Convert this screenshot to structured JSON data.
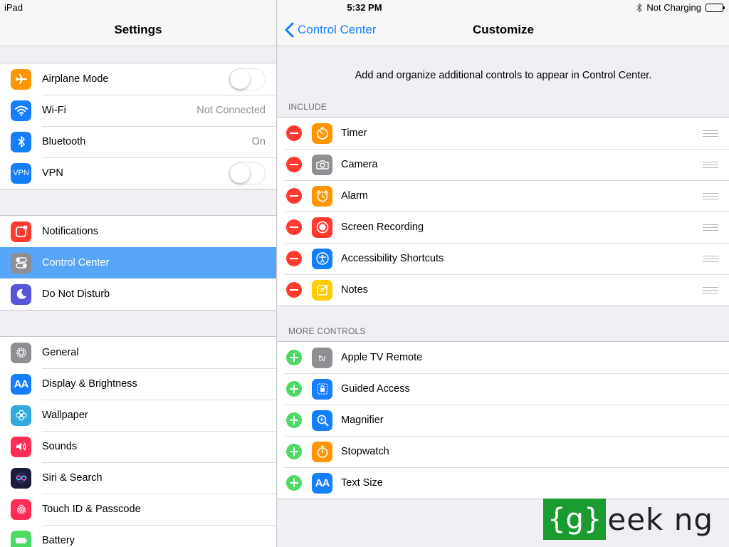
{
  "status_bar": {
    "device": "iPad",
    "time": "5:32 PM",
    "charging": "Not Charging"
  },
  "settings": {
    "title": "Settings",
    "groups": [
      [
        {
          "label": "Airplane Mode",
          "icon": "airplane-icon",
          "color": "#ff9500",
          "control": "toggle",
          "on": false
        },
        {
          "label": "Wi-Fi",
          "icon": "wifi-icon",
          "color": "#147efb",
          "value": "Not Connected"
        },
        {
          "label": "Bluetooth",
          "icon": "bluetooth-icon",
          "color": "#147efb",
          "value": "On"
        },
        {
          "label": "VPN",
          "icon": "vpn-icon",
          "icon_text": "VPN",
          "color": "#147efb",
          "control": "toggle",
          "on": false
        }
      ],
      [
        {
          "label": "Notifications",
          "icon": "notifications-icon",
          "color": "#ff3b30"
        },
        {
          "label": "Control Center",
          "icon": "control-center-icon",
          "color": "#8e8e93",
          "selected": true
        },
        {
          "label": "Do Not Disturb",
          "icon": "moon-icon",
          "color": "#5856d6"
        }
      ],
      [
        {
          "label": "General",
          "icon": "gear-icon",
          "color": "#8e8e93"
        },
        {
          "label": "Display & Brightness",
          "icon": "text-size-icon",
          "icon_text": "AA",
          "color": "#147efb"
        },
        {
          "label": "Wallpaper",
          "icon": "wallpaper-flower-icon",
          "color": "#34aadc"
        },
        {
          "label": "Sounds",
          "icon": "speaker-icon",
          "color": "#ff2d55"
        },
        {
          "label": "Siri & Search",
          "icon": "siri-icon",
          "color": "#1b1b3a"
        },
        {
          "label": "Touch ID & Passcode",
          "icon": "fingerprint-icon",
          "color": "#ff2d55"
        },
        {
          "label": "Battery",
          "icon": "battery-icon",
          "color": "#4cd964"
        }
      ]
    ]
  },
  "customize": {
    "back_label": "Control Center",
    "title": "Customize",
    "description": "Add and organize additional controls to appear in Control Center.",
    "include_header": "INCLUDE",
    "include": [
      {
        "label": "Timer",
        "icon": "timer-icon",
        "color": "#ff9500"
      },
      {
        "label": "Camera",
        "icon": "camera-icon",
        "color": "#8e8e93"
      },
      {
        "label": "Alarm",
        "icon": "alarm-icon",
        "color": "#ff9500"
      },
      {
        "label": "Screen Recording",
        "icon": "screen-recording-icon",
        "color": "#ff3b30"
      },
      {
        "label": "Accessibility Shortcuts",
        "icon": "accessibility-icon",
        "color": "#147efb"
      },
      {
        "label": "Notes",
        "icon": "notes-icon",
        "color": "#ffcc00"
      }
    ],
    "more_header": "MORE CONTROLS",
    "more": [
      {
        "label": "Apple TV Remote",
        "icon": "apple-tv-icon",
        "icon_text": "tv",
        "color": "#8e8e93"
      },
      {
        "label": "Guided Access",
        "icon": "lock-icon",
        "color": "#147efb"
      },
      {
        "label": "Magnifier",
        "icon": "magnifier-icon",
        "color": "#147efb"
      },
      {
        "label": "Stopwatch",
        "icon": "stopwatch-icon",
        "color": "#ff9500"
      },
      {
        "label": "Text Size",
        "icon": "text-size-icon",
        "icon_text": "AA",
        "color": "#147efb"
      }
    ]
  },
  "watermark": {
    "boxed": "{g}",
    "rest": "eek ng"
  }
}
